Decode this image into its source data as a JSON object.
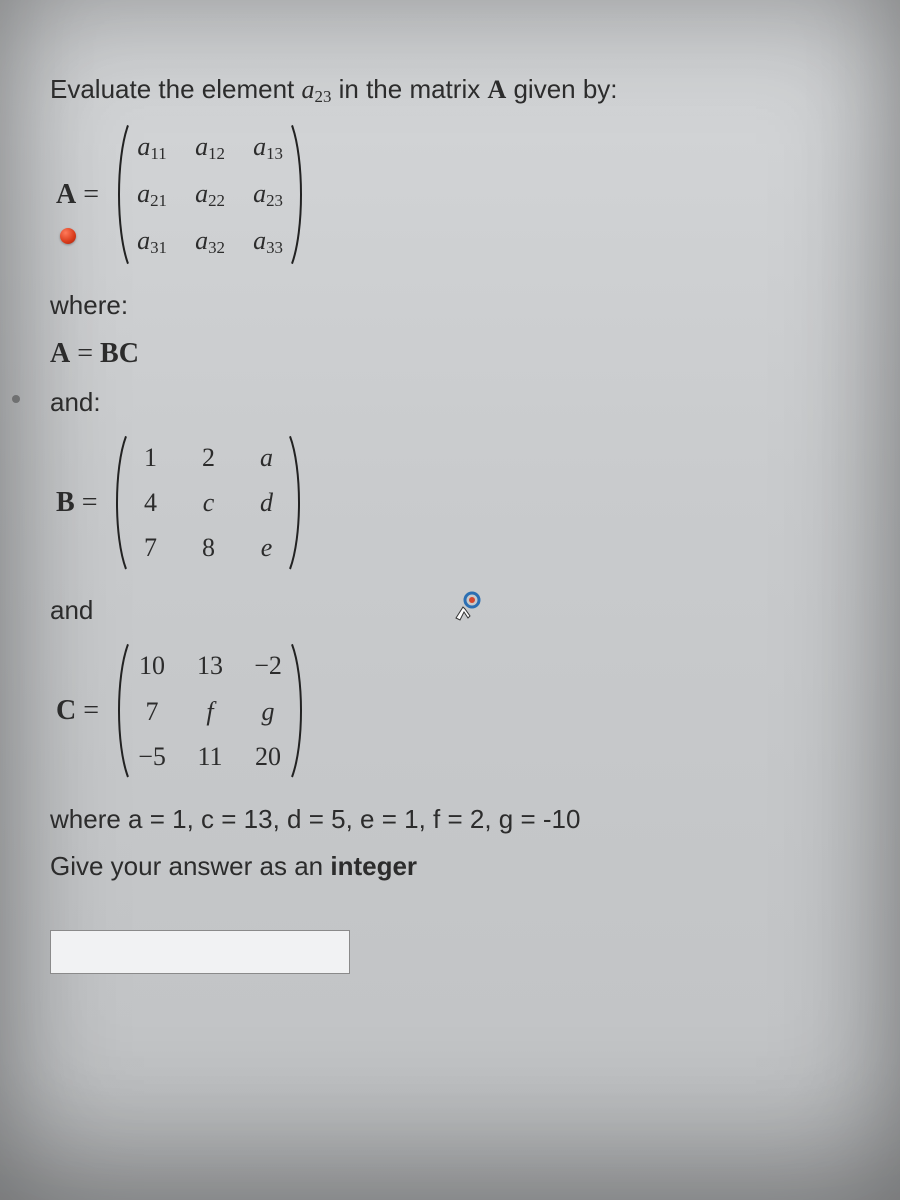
{
  "prompt": {
    "prefix": "Evaluate the element ",
    "target_base": "a",
    "target_sub": "23",
    "middle": " in the matrix ",
    "matrix_name": "A",
    "suffix": " given by:"
  },
  "matrixA": {
    "lhs": "A",
    "eq": "=",
    "cells": [
      [
        "a",
        "11",
        "a",
        "12",
        "a",
        "13"
      ],
      [
        "a",
        "21",
        "a",
        "22",
        "a",
        "23"
      ],
      [
        "a",
        "31",
        "a",
        "32",
        "a",
        "33"
      ]
    ]
  },
  "where_label": "where:",
  "relation": {
    "lhs": "A",
    "eq": " = ",
    "rhs": "BC"
  },
  "and1": "and:",
  "matrixB": {
    "lhs": "B",
    "eq": "=",
    "rows": [
      [
        "1",
        "2",
        "a"
      ],
      [
        "4",
        "c",
        "d"
      ],
      [
        "7",
        "8",
        "e"
      ]
    ]
  },
  "and2": "and",
  "matrixC": {
    "lhs": "C",
    "eq": "=",
    "rows": [
      [
        "10",
        "13",
        "−2"
      ],
      [
        "7",
        "f",
        "g"
      ],
      [
        "−5",
        "11",
        "20"
      ]
    ]
  },
  "values_line": "where a = 1, c = 13, d = 5, e = 1, f = 2, g = -10",
  "instruction_prefix": "Give your answer as an ",
  "instruction_bold": "integer",
  "answer_value": ""
}
